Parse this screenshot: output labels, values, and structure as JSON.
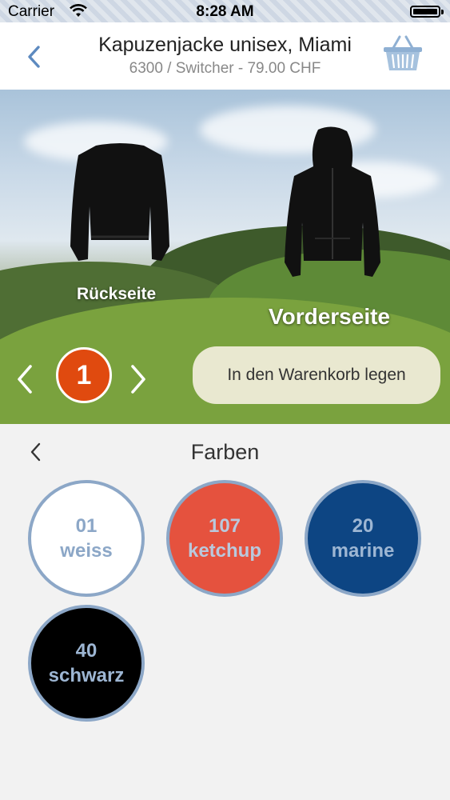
{
  "status_bar": {
    "carrier": "Carrier",
    "time": "8:28 AM"
  },
  "nav": {
    "title": "Kapuzenjacke unisex, Miami",
    "subtitle": "6300 / Switcher - 79.00 CHF"
  },
  "product": {
    "back_label": "Rückseite",
    "front_label": "Vorderseite",
    "quantity": "1",
    "add_to_cart_label": "In den Warenkorb legen"
  },
  "colors": {
    "title": "Farben",
    "items": [
      {
        "code": "01",
        "name": "weiss",
        "fill": "#ffffff",
        "text": "#8ca7c7"
      },
      {
        "code": "107",
        "name": "ketchup",
        "fill": "#e5523e",
        "text": "#b9c9dd"
      },
      {
        "code": "20",
        "name": "marine",
        "fill": "#0d4583",
        "text": "#9db6d3"
      },
      {
        "code": "40",
        "name": "schwarz",
        "fill": "#000000",
        "text": "#9db6d3"
      }
    ]
  },
  "icons": [
    "back-chevron-icon",
    "basket-icon",
    "chevron-left-icon",
    "chevron-right-icon",
    "wifi-icon",
    "battery-icon"
  ]
}
